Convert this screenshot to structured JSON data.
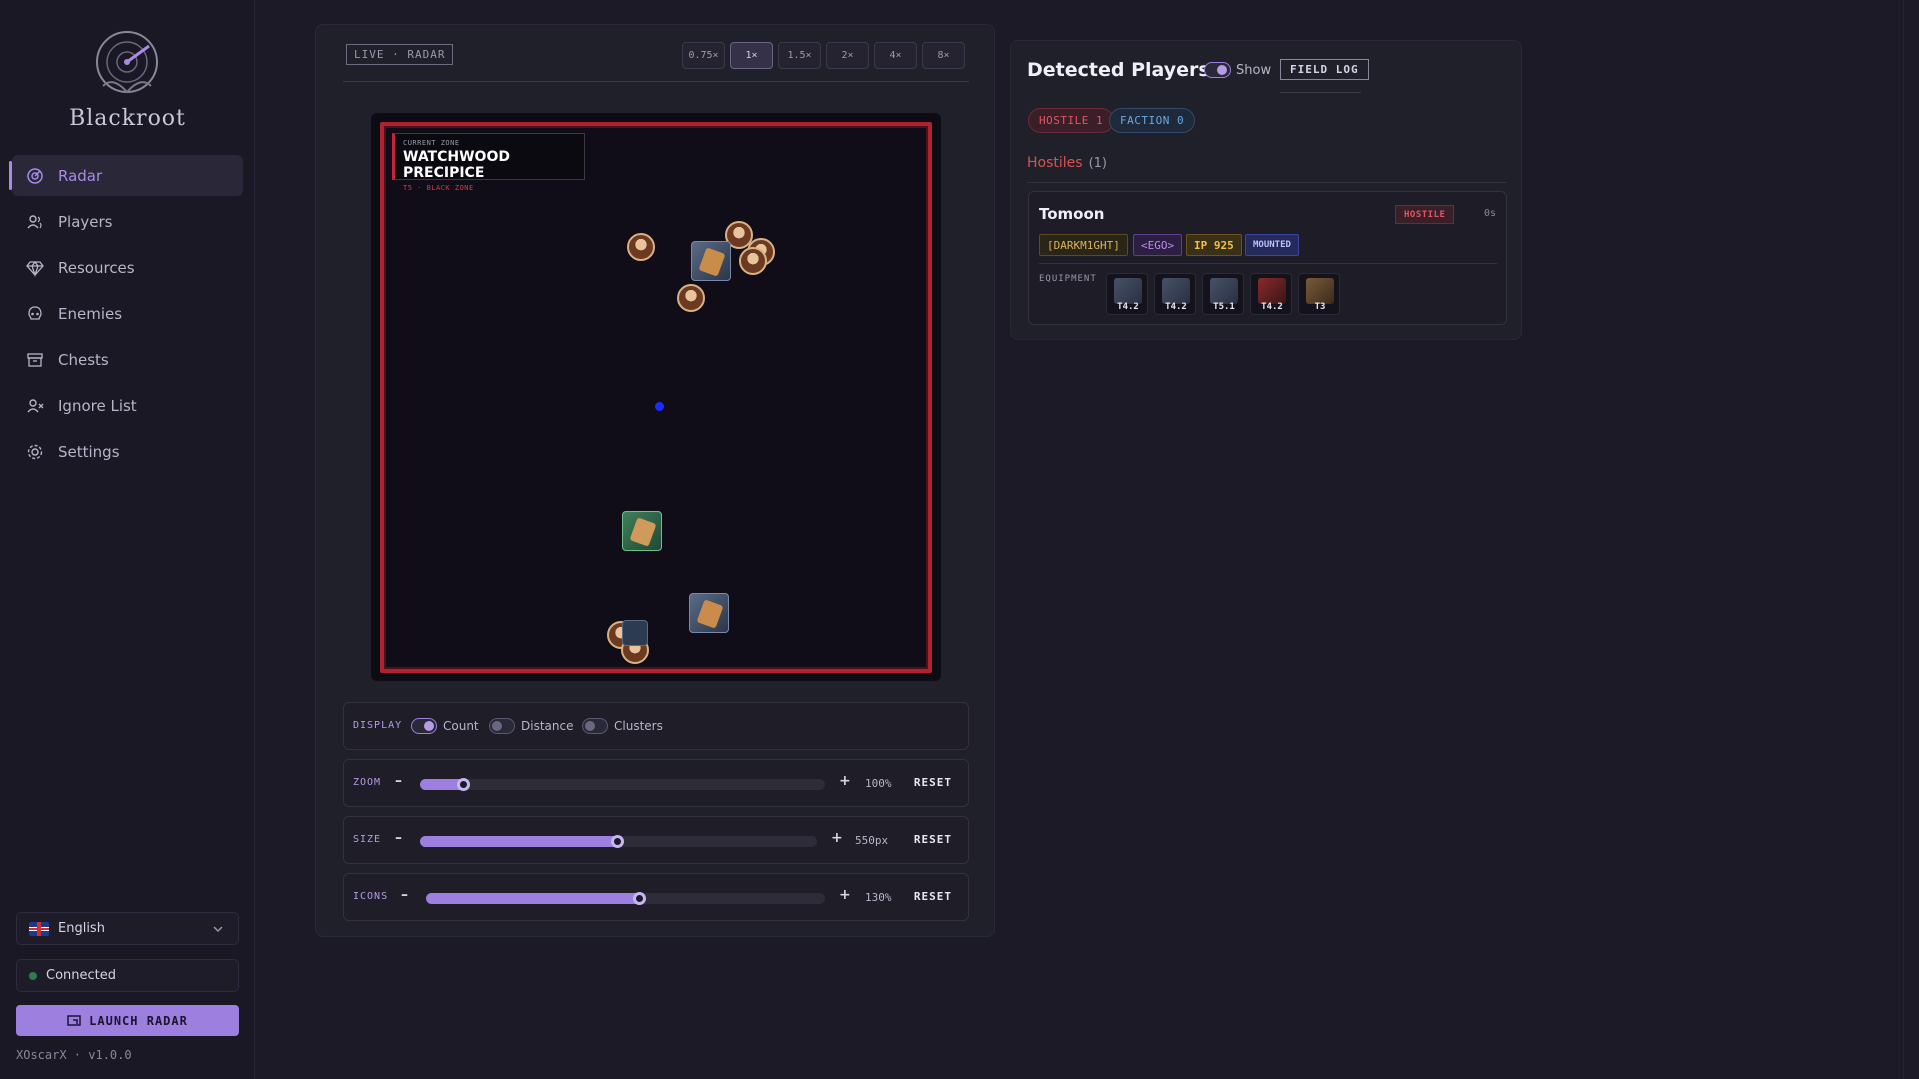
{
  "app": {
    "name": "Blackroot",
    "version_line": "XOscarX · v1.0.0"
  },
  "sidebar": {
    "items": [
      {
        "label": "Radar",
        "icon": "radar-icon",
        "active": true
      },
      {
        "label": "Players",
        "icon": "users-icon"
      },
      {
        "label": "Resources",
        "icon": "gem-icon"
      },
      {
        "label": "Enemies",
        "icon": "skull-icon"
      },
      {
        "label": "Chests",
        "icon": "chest-icon"
      },
      {
        "label": "Ignore List",
        "icon": "user-x-icon"
      },
      {
        "label": "Settings",
        "icon": "gear-icon"
      }
    ],
    "language": "English",
    "status": "Connected",
    "launch_label": "LAUNCH RADAR"
  },
  "radar": {
    "badge": "LIVE · RADAR",
    "zoom_buttons": [
      "0.75×",
      "1×",
      "1.5×",
      "2×",
      "4×",
      "8×"
    ],
    "active_zoom": "1×",
    "zone": {
      "label": "CURRENT ZONE",
      "name": "WATCHWOOD PRECIPICE",
      "sub": "T5 · BLACK ZONE"
    },
    "display": {
      "label": "DISPLAY",
      "toggles": [
        {
          "label": "Count",
          "on": true
        },
        {
          "label": "Distance",
          "on": false
        },
        {
          "label": "Clusters",
          "on": false
        }
      ]
    },
    "sliders": [
      {
        "label": "ZOOM",
        "value": "100%",
        "fraction": 0.11,
        "reset": "RESET"
      },
      {
        "label": "SIZE",
        "value": "550px",
        "fraction": 0.5,
        "reset": "RESET"
      },
      {
        "label": "ICONS",
        "value": "130%",
        "fraction": 0.54,
        "reset": "RESET"
      }
    ]
  },
  "players": {
    "title": "Detected Players",
    "show_label": "Show",
    "field_log": "FIELD LOG",
    "hostile_pill": "HOSTILE 1",
    "faction_pill": "FACTION 0",
    "hostiles_header": "Hostiles",
    "hostiles_count": "(1)",
    "card": {
      "name": "Tomoon",
      "status": "HOSTILE",
      "time": "0s",
      "guild": "[DARKM1GHT]",
      "alliance": "<EGO>",
      "ip": "IP 925",
      "mounted": "MOUNTED",
      "equipment_label": "EQUIPMENT",
      "equipment": [
        "T4.2",
        "T4.2",
        "T5.1",
        "T4.2",
        "T3"
      ]
    }
  },
  "colors": {
    "accent": "#9d7fe0",
    "hostile": "#e15566",
    "faction": "#6fa6e0",
    "zone_border": "#b02230"
  }
}
